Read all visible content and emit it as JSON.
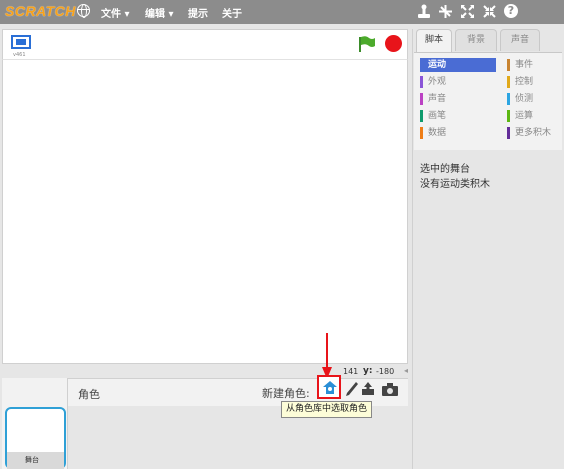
{
  "menubar": {
    "logo": "SCRATCH",
    "menus": [
      "文件 ▾",
      "编辑 ▾",
      "提示",
      "关于"
    ]
  },
  "stage": {
    "version": "v461",
    "coord_x": "141",
    "coord_y_label": "y:",
    "coord_y": "-180"
  },
  "sprites": {
    "title": "角色",
    "new_sprite_label": "新建角色:",
    "stage_thumb_label": "舞台",
    "tooltip": "从角色库中选取角色"
  },
  "tabs": [
    "脚本",
    "背景",
    "声音"
  ],
  "categories": [
    {
      "label": "运动",
      "color": "#4a6cd4"
    },
    {
      "label": "事件",
      "color": "#c88330"
    },
    {
      "label": "外观",
      "color": "#8a55d7"
    },
    {
      "label": "控制",
      "color": "#e1a91a"
    },
    {
      "label": "声音",
      "color": "#bb42c3"
    },
    {
      "label": "侦测",
      "color": "#2ca5e2"
    },
    {
      "label": "画笔",
      "color": "#0e9a6c"
    },
    {
      "label": "运算",
      "color": "#5cb712"
    },
    {
      "label": "数据",
      "color": "#ee7d16"
    },
    {
      "label": "更多积木",
      "color": "#632d99"
    }
  ],
  "info": {
    "line1": "选中的舞台",
    "line2": "没有运动类积木"
  },
  "colors": {
    "menubar": "#8c8c8c",
    "accent_blue": "#4a6cd4",
    "highlight_red": "#e8141a"
  }
}
